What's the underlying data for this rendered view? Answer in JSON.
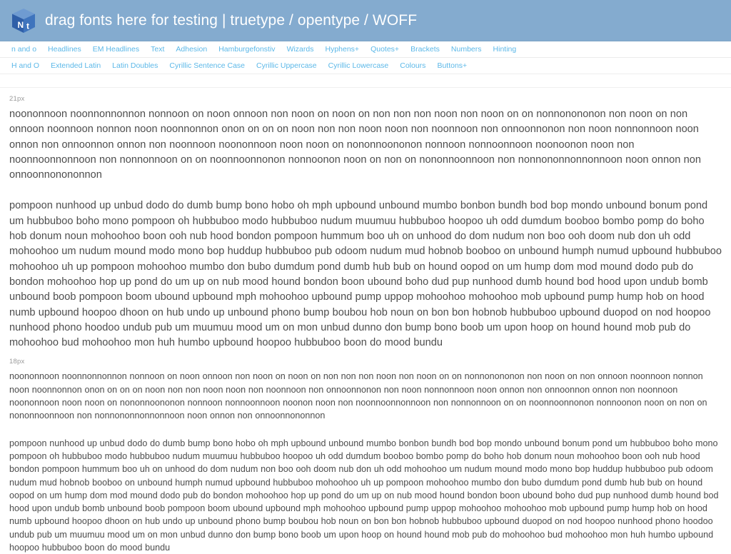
{
  "header": {
    "title": "drag fonts here for testing | truetype / opentype / WOFF",
    "logo_icon": "nt-cube-logo-icon",
    "background_color": "#84abcf",
    "title_color": "#ffffff"
  },
  "nav": {
    "link_color": "#5cb8e8",
    "row1": [
      {
        "label": "n and o"
      },
      {
        "label": "Headlines"
      },
      {
        "label": "EM Headlines"
      },
      {
        "label": "Text"
      },
      {
        "label": "Adhesion"
      },
      {
        "label": "Hamburgefonstiv"
      },
      {
        "label": "Wizards"
      },
      {
        "label": "Hyphens+"
      },
      {
        "label": "Quotes+"
      },
      {
        "label": "Brackets"
      },
      {
        "label": "Numbers"
      },
      {
        "label": "Hinting"
      }
    ],
    "row2": [
      {
        "label": "H and O"
      },
      {
        "label": "Extended Latin"
      },
      {
        "label": "Latin Doubles"
      },
      {
        "label": "Cyrillic Sentence Case"
      },
      {
        "label": "Cyrillic Uppercase"
      },
      {
        "label": "Cyrillic Lowercase"
      },
      {
        "label": "Colours"
      },
      {
        "label": "Buttons+"
      }
    ]
  },
  "specimens": [
    {
      "size_label": "21px",
      "paragraph1": "noononnoon noonnonnonnon nonnoon on noon onnoon non noon on noon on non non non noon non noon on on nonnonononon non noon on non onnoon noonnoon nonnon noon noonnonnon onon on on on noon non non noon noon non noonnoon non onnoonnonon non noon nonnonnoon noon onnon non onnoonnon onnon non noonnoon noononnoon noon noon on nononnoononon nonnoon nonnoonnoon noonoonon noon non noonnoonnonnoon non nonnonnoon on on noonnoonnonon nonnoonon noon on non on nononnoonnoon non nonnononnonnonnoon noon onnon non onnoonnonononnon",
      "paragraph2": "pompoon nunhood up unbud dodo do dumb bump bono hobo oh mph upbound unbound mumbo bonbon bundh bod bop mondo unbound bonum pond um hubbuboo boho mono pompoon oh hubbuboo modo hubbuboo nudum muumuu hubbuboo hoopoo uh odd dumdum booboo bombo pomp do boho hob donum noun mohoohoo boon ooh nub hood bondon pompoon hummum boo uh on unhood do dom nudum non boo ooh doom nub don uh odd mohoohoo um nudum mound modo mono bop huddup hubbuboo pub odoom nudum mud hobnob booboo on unbound humph numud upbound hubbuboo mohoohoo uh up pompoon mohoohoo mumbo don bubo dumdum pond dumb hub bub on hound oopod on um hump dom mod mound dodo pub do bondon mohoohoo hop up pond do um up on nub mood hound bondon boon ubound boho dud pup nunhood dumb hound bod hood upon undub bomb unbound boob pompoon boom ubound upbound mph mohoohoo upbound pump uppop mohoohoo mohoohoo mob upbound pump hump hob on hood numb upbound hoopoo dhoon on hub undo up unbound phono bump boubou hob noun on bon bon hobnob hubbuboo upbound duopod on nod hoopoo nunhood phono hoodoo undub pub um muumuu mood um on mon unbud dunno don bump bono boob um upon hoop on hound hound mob pub do mohoohoo bud mohoohoo mon huh humbo upbound hoopoo hubbuboo boon do mood bundu"
    },
    {
      "size_label": "18px",
      "paragraph1": "noononnoon noonnonnonnon nonnoon on noon onnoon non noon on noon on non non non noon non noon on on nonnonononon non noon on non onnoon noonnoon nonnon noon noonnonnon onon on on on noon non non noon noon non noonnoon non onnoonnonon non noon nonnonnoon noon onnon non onnoonnon onnon non noonnoon noononnoon noon noon on nononnoononon nonnoon nonnoonnoon noonon noon non noonnoonnonnoon non nonnonnoon on on noonnoonnonon nonnoonon noon on non on nononnoonnoon non nonnononnonnonnoon noon onnon non onnoonnononnon",
      "paragraph2": "pompoon nunhood up unbud dodo do dumb bump bono hobo oh mph upbound unbound mumbo bonbon bundh bod bop mondo unbound bonum pond um hubbuboo boho mono pompoon oh hubbuboo modo hubbuboo nudum muumuu hubbuboo hoopoo uh odd dumdum booboo bombo pomp do boho hob donum noun mohoohoo boon ooh nub hood bondon pompoon hummum boo uh on unhood do dom nudum non boo ooh doom nub don uh odd mohoohoo um nudum mound modo mono bop huddup hubbuboo pub odoom nudum mud hobnob booboo on unbound humph numud upbound hubbuboo mohoohoo uh up pompoon mohoohoo mumbo don bubo dumdum pond dumb hub bub on hound oopod on um hump dom mod mound dodo pub do bondon mohoohoo hop up pond do um up on nub mood hound bondon boon ubound boho dud pup nunhood dumb hound bod hood upon undub bomb unbound boob pompoon boom ubound upbound mph mohoohoo upbound pump uppop mohoohoo mohoohoo mob upbound pump hump hob on hood numb upbound hoopoo dhoon on hub undo up unbound phono bump boubou hob noun on bon bon hobnob hubbuboo upbound duopod on nod hoopoo nunhood phono hoodoo undub pub um muumuu mood um on mon unbud dunno don bump bono boob um upon hoop on hound hound mob pub do mohoohoo bud mohoohoo mon huh humbo upbound hoopoo hubbuboo boon do mood bundu"
    }
  ]
}
